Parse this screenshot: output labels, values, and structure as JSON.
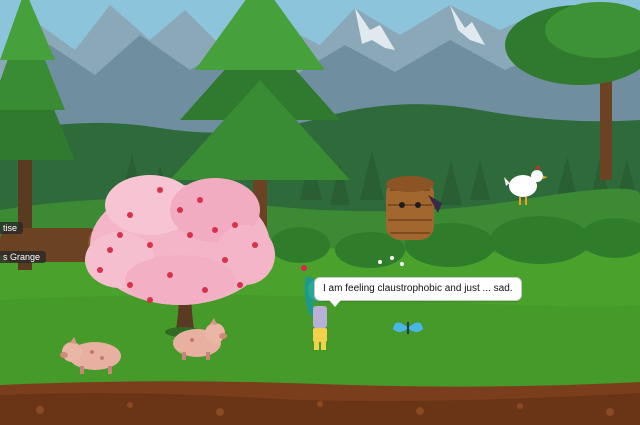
{
  "world": {
    "location_tags": [
      "tise",
      "s Grange"
    ]
  },
  "player": {
    "speech": "I am feeling claustrophobic and just ... sad."
  },
  "colors": {
    "sky": "#7ab6d6",
    "grass": "#3e9a2a",
    "soil": "#7a3e1c",
    "blossom": "#f4b5c8"
  }
}
